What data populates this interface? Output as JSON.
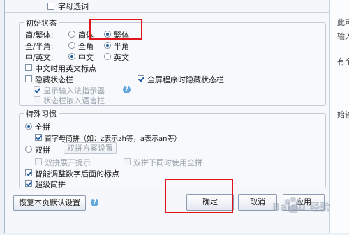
{
  "top_partial": {
    "label": "字母选词",
    "checked": false
  },
  "initial_state": {
    "title": "初始状态",
    "trad_simp": {
      "label": "简/繁体:",
      "options": [
        "简体",
        "繁体"
      ],
      "selected": "繁体"
    },
    "width": {
      "label": "全/半角:",
      "options": [
        "全角",
        "半角"
      ],
      "selected": "半角"
    },
    "lang": {
      "label": "中/英文:",
      "options": [
        "中文",
        "英文"
      ],
      "selected": "中文"
    },
    "chinese_en_punct": {
      "label": "中文时用英文标点",
      "checked": false
    },
    "hide_status": {
      "label": "隐藏状态栏",
      "checked": false
    },
    "fullscreen_hide": {
      "label": "全屏程序时隐藏状态栏",
      "checked": true
    },
    "show_indicator": {
      "label": "显示输入法指示器",
      "checked": true
    },
    "embed_lang_bar": {
      "label": "状态栏嵌入语言栏",
      "checked": false
    }
  },
  "special": {
    "title": "特殊习惯",
    "full_pinyin": {
      "label": "全拼",
      "selected": true
    },
    "initial_abbrev": {
      "label": "首字母简拼（如：z表示zh等，a表示an等）",
      "checked": true
    },
    "double_pinyin": {
      "label": "双拼",
      "selected": false
    },
    "double_scheme_button": "双拼方案设置",
    "double_expand_hint": {
      "label": "双拼展开提示",
      "checked": false
    },
    "double_also_full": {
      "label": "双拼下同时使用全拼",
      "checked": false
    },
    "smart_punct": {
      "label": "智能调整数字后面的标点",
      "checked": true
    },
    "super_abbrev": {
      "label": "超级简拼",
      "checked": true
    }
  },
  "buttons": {
    "restore": "恢复本页默认设置",
    "ok": "确定",
    "cancel": "取消",
    "apply": "应用"
  },
  "right_fragments": [
    "此可",
    "输入",
    "有个",
    "始输"
  ],
  "watermark_text": "Baidu 经验",
  "colors": {
    "highlight": "#e0141b",
    "accent": "#1e5aa0"
  }
}
